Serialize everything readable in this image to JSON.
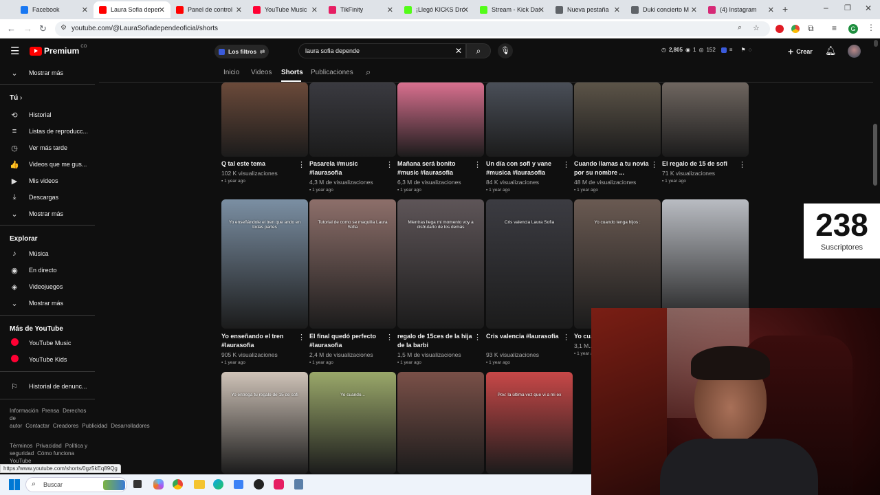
{
  "browser": {
    "tabs": [
      {
        "label": "Facebook",
        "color": "#1877f2"
      },
      {
        "label": "Laura Sofia depen",
        "color": "#ff0000"
      },
      {
        "label": "Panel de control",
        "color": "#ff0000"
      },
      {
        "label": "YouTube Music",
        "color": "#ff0033"
      },
      {
        "label": "TikFinity",
        "color": "#e61e63"
      },
      {
        "label": "¡Llegó KICKS Drop",
        "color": "#53fc18"
      },
      {
        "label": "Stream - Kick Das",
        "color": "#53fc18"
      },
      {
        "label": "Nueva pestaña",
        "color": "#5f6368"
      },
      {
        "label": "Duki concierto M",
        "color": "#5f6368"
      },
      {
        "label": "(4) Instagram",
        "color": "#d62976"
      }
    ],
    "url": "youtube.com/@LauraSofiadependeoficial/shorts",
    "status_url": "https://www.youtube.com/shorts/0gz5kEq89Qg"
  },
  "header": {
    "logo": "Premium",
    "logo_sup": "CO",
    "filters": "Los filtros",
    "search_value": "laura sofia depende",
    "stats": {
      "views": "2,805",
      "a": "1",
      "b": "152"
    },
    "create": "Crear"
  },
  "sidebar": {
    "mostrar_mas_top": "Mostrar más",
    "tu": "Tú",
    "tu_items": [
      {
        "label": "Historial",
        "icon": "history-icon",
        "glyph": "⟲"
      },
      {
        "label": "Listas de reproducc...",
        "icon": "playlist-icon",
        "glyph": "≡"
      },
      {
        "label": "Ver más tarde",
        "icon": "clock-icon",
        "glyph": "◷"
      },
      {
        "label": "Videos que me gus...",
        "icon": "thumbs-up-icon",
        "glyph": "👍"
      },
      {
        "label": "Mis videos",
        "icon": "video-icon",
        "glyph": "▶"
      },
      {
        "label": "Descargas",
        "icon": "download-icon",
        "glyph": "⤓"
      },
      {
        "label": "Mostrar más",
        "icon": "chevron-down-icon",
        "glyph": "⌄"
      }
    ],
    "explorar": "Explorar",
    "explorar_items": [
      {
        "label": "Música",
        "icon": "music-icon",
        "glyph": "♪"
      },
      {
        "label": "En directo",
        "icon": "live-icon",
        "glyph": "◉"
      },
      {
        "label": "Videojuegos",
        "icon": "gaming-icon",
        "glyph": "◈"
      },
      {
        "label": "Mostrar más",
        "icon": "chevron-down-icon",
        "glyph": "⌄"
      }
    ],
    "mas_yt": "Más de YouTube",
    "mas_items": [
      {
        "label": "YouTube Music",
        "icon": "yt-music-icon"
      },
      {
        "label": "YouTube Kids",
        "icon": "yt-kids-icon"
      }
    ],
    "historial_denuncias": "Historial de denunc...",
    "footer1": [
      "Información",
      "Prensa",
      "Derechos de autor",
      "Contactar",
      "Creadores",
      "Publicidad",
      "Desarrolladores"
    ],
    "footer2": [
      "Términos",
      "Privacidad",
      "Política y seguridad",
      "Cómo funciona YouTube"
    ]
  },
  "channel_tabs": [
    "Inicio",
    "Videos",
    "Shorts",
    "Publicaciones"
  ],
  "shorts_row1": [
    {
      "title": "Q tal este tema",
      "views": "102 K visualizaciones",
      "ago": "1 year ago",
      "bg": "#6b4a3a"
    },
    {
      "title": "Pasarela #music #laurasofia",
      "views": "4,3 M de visualizaciones",
      "ago": "1 year ago",
      "bg": "#3a3a40"
    },
    {
      "title": "Mañana será bonito #music #laurasofia",
      "views": "6,3 M de visualizaciones",
      "ago": "1 year ago",
      "bg": "#d9708f"
    },
    {
      "title": "Un día con sofi y vane #musica #laurasofia",
      "views": "84 K visualizaciones",
      "ago": "1 year ago",
      "bg": "#4a4f58"
    },
    {
      "title": "Cuando llamas a tu novia por su nombre ...",
      "views": "48 M de visualizaciones",
      "ago": "1 year ago",
      "bg": "#5c5448"
    },
    {
      "title": "El regalo de 15 de sofi",
      "views": "71 K visualizaciones",
      "ago": "1 year ago",
      "bg": "#6f6660"
    }
  ],
  "shorts_row2": [
    {
      "title": "Yo enseñando el tren #laurasofia",
      "views": "905 K visualizaciones",
      "ago": "1 year ago",
      "bg": "#7b8fa3",
      "overlay": "Yo enseñándole el tren que ando en todas partes"
    },
    {
      "title": "El final quedó perfecto #laurasofia",
      "views": "2,4 M de visualizaciones",
      "ago": "1 year ago",
      "bg": "#8d6f6a",
      "overlay": "Tutorial de como se maquilla Laura Sofia"
    },
    {
      "title": "regalo de 15ces de la hija de la barbi",
      "views": "1,5 M de visualizaciones",
      "ago": "1 year ago",
      "bg": "#5e5558",
      "overlay": "Mientras llega mi momento voy a disfrutarlo de los demás"
    },
    {
      "title": "Cris valencia #laurasofia",
      "views": "93 K visualizaciones",
      "ago": "1 year ago",
      "bg": "#3c3c42",
      "overlay": "Cris valencia Laura Sofia"
    },
    {
      "title": "Yo cu...",
      "views": "3,1 M...",
      "ago": "1 year ago",
      "bg": "#6a5a52",
      "overlay": "Yo cuando tenga hijos :"
    },
    {
      "title": "",
      "views": "",
      "ago": "",
      "bg": "#b9bcc2",
      "overlay": ""
    }
  ],
  "shorts_row3": [
    {
      "bg": "#cfc3b8",
      "overlay": "Yo entrega tu regalo de 15 de sofi"
    },
    {
      "bg": "#9aa86a",
      "overlay": "Yo cuando..."
    },
    {
      "bg": "#7a5048",
      "overlay": ""
    },
    {
      "bg": "#c84848",
      "overlay": "Pov: la última vez que vi a mi ex"
    }
  ],
  "subscriber": {
    "count": "238",
    "label": "Suscriptores"
  },
  "taskbar": {
    "search": "Buscar"
  }
}
